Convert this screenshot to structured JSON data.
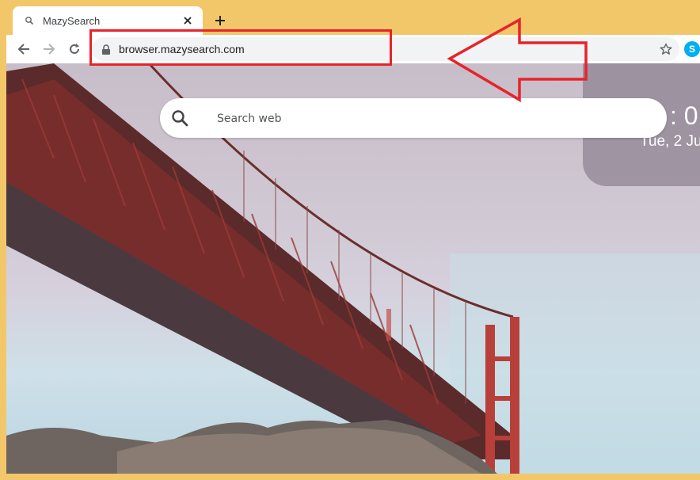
{
  "browser": {
    "tab": {
      "title": "MazySearch",
      "icon": "search-icon"
    },
    "new_tab_symbol": "+",
    "url": "browser.mazysearch.com",
    "extension_letter": "S"
  },
  "page": {
    "search": {
      "placeholder": "Search web"
    },
    "clock": {
      "time": ": 0",
      "date": "Tue, 2 Ju"
    }
  },
  "colors": {
    "frame": "#f2c76a",
    "annotation": "#e8232a",
    "omnibox": "#f1f3f4",
    "bridge": "#7a2e2c"
  }
}
